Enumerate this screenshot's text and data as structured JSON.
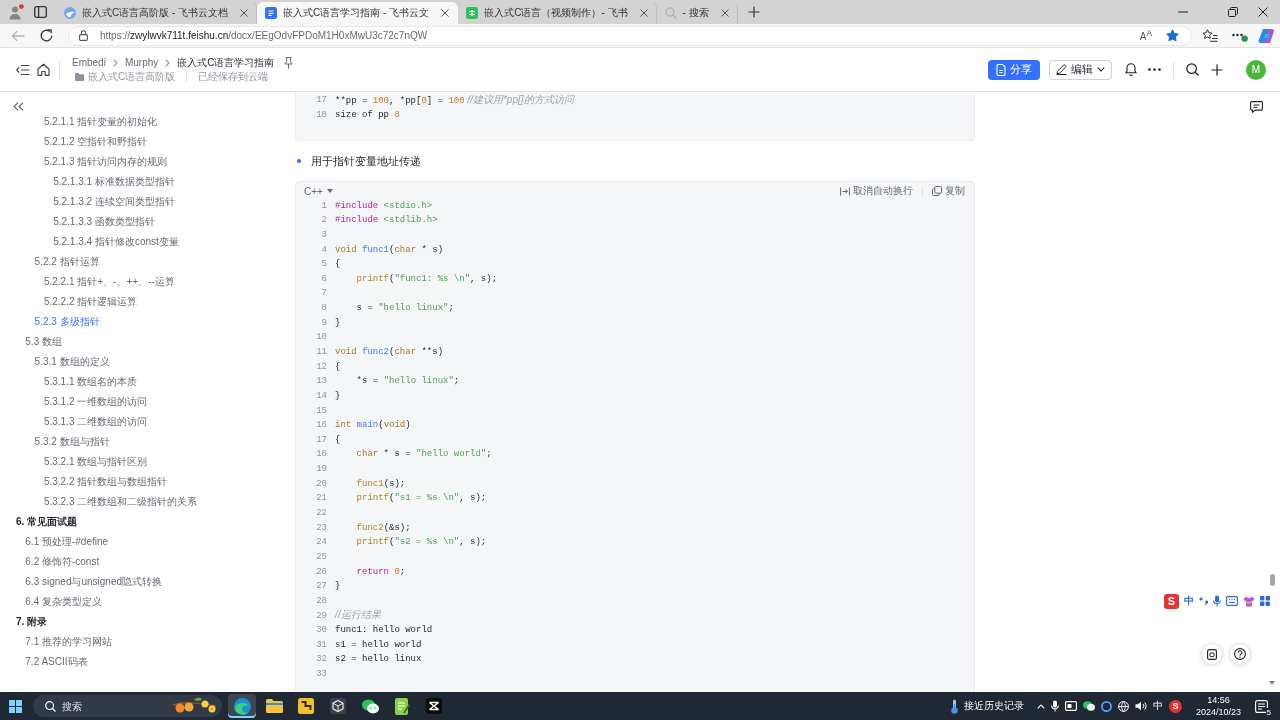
{
  "browser": {
    "tabs": [
      {
        "title": "嵌入式C语言高阶版 - 飞书云文档",
        "kind": "ball",
        "selected": false
      },
      {
        "title": "嵌入式C语言学习指南 - 飞书云文",
        "kind": "doc",
        "selected": true
      },
      {
        "title": "嵌入式C语言（视频制作）- 飞书",
        "kind": "sheet",
        "selected": false
      },
      {
        "title": "- 搜索",
        "kind": "search",
        "selected": false
      }
    ],
    "back_disabled": true,
    "url": {
      "scheme": "https://",
      "host": "zwylwvk711t.feishu.cn",
      "path": "/docx/EEgOdvFPDoM1H0xMwU3c72c7nQW"
    },
    "read_aloud": "A$^{A}$",
    "favorited": true
  },
  "doc_header": {
    "breadcrumb": [
      "Embedi",
      "Murphy",
      "嵌入式C语言学习指南"
    ],
    "location": "嵌入式C语言高阶版",
    "save_status": "已经保存到云端",
    "share_label": "分享",
    "edit_label": "编辑",
    "avatar": "M"
  },
  "toc": [
    {
      "children": [
        {
          "children": [
            {
              "children": [
                {
                  "label": "5.2.1.1 指针变量的初始化",
                  "selected": false
                },
                {
                  "label": "5.2.1.2 空指针和野指针",
                  "selected": false
                },
                {
                  "label": "5.2.1.3 指针访问内存的规则",
                  "selected": false,
                  "children": [
                    {
                      "label": "5.2.1.3.1 标准数据类型指针",
                      "selected": false
                    },
                    {
                      "label": "5.2.1.3.2 连续空间类型指针",
                      "selected": false
                    },
                    {
                      "label": "5.2.1.3.3 函数类型指针",
                      "selected": false
                    },
                    {
                      "label": "5.2.1.3.4 指针修改const变量",
                      "selected": false
                    }
                  ]
                }
              ]
            },
            {
              "label": "5.2.2 指针运算",
              "selected": false,
              "children": [
                {
                  "label": "5.2.2.1 指针+、-、++、--运算",
                  "selected": false
                },
                {
                  "label": "5.2.2.2 指针逻辑运算",
                  "selected": false
                }
              ]
            },
            {
              "label": "5.2.3 多级指针",
              "selected": true
            }
          ]
        },
        {
          "label": "5.3 数组",
          "selected": false,
          "children": [
            {
              "label": "5.3.1 数组的定义",
              "selected": false,
              "children": [
                {
                  "label": "5.3.1.1 数组名的本质",
                  "selected": false
                },
                {
                  "label": "5.3.1.2 一维数组的访问",
                  "selected": false
                },
                {
                  "label": "5.3.1.3 二维数组的访问",
                  "selected": false
                }
              ]
            },
            {
              "label": "5.3.2 数组与指针",
              "selected": false,
              "children": [
                {
                  "label": "5.3.2.1 数组与指针区别",
                  "selected": false
                },
                {
                  "label": "5.3.2.2 指针数组与数组指针",
                  "selected": false
                },
                {
                  "label": "5.3.2.3 二维数组和二级指针的关系",
                  "selected": false
                }
              ]
            }
          ]
        }
      ]
    },
    {
      "label": "6. 常见面试题",
      "selected": false,
      "children": [
        {
          "label": "6.1 预处理-#define",
          "selected": false
        },
        {
          "label": "6.2 修饰符-const",
          "selected": false
        },
        {
          "label": "6.3 signed与unsigned隐式转换",
          "selected": false
        },
        {
          "label": "6.4 复杂类型定义",
          "selected": false
        }
      ]
    },
    {
      "label": "7. 附录",
      "selected": false,
      "children": [
        {
          "label": "7.1 推荐的学习网站",
          "selected": false
        },
        {
          "label": "7.2 ASCII码表",
          "selected": false
        }
      ]
    }
  ],
  "content": [
    {
      "kind": "code",
      "continued": true,
      "lines": [
        {
          "number": "17",
          "tokens": [
            {
              "kind": "plain",
              "text": "**pp = "
            },
            {
              "kind": "number",
              "text": "100"
            },
            {
              "kind": "plain",
              "text": ", *pp["
            },
            {
              "kind": "number",
              "text": "0"
            },
            {
              "kind": "plain",
              "text": "] = "
            },
            {
              "kind": "number",
              "text": "100"
            },
            {
              "kind": "comment",
              "text": " //建议用*pp[]的方式访问"
            }
          ]
        },
        {
          "number": "18",
          "tokens": [
            {
              "kind": "plain",
              "text": "size of pp "
            },
            {
              "kind": "number",
              "text": "8"
            }
          ]
        }
      ]
    },
    {
      "kind": "bullet",
      "text": "用于指针变量地址传递"
    },
    {
      "kind": "code",
      "continued": false,
      "language": "C++",
      "wrap_label": "取消自动换行",
      "copy_label": "复制",
      "lines": [
        {
          "number": "1",
          "tokens": [
            {
              "kind": "preproc",
              "text": "#include "
            },
            {
              "kind": "string",
              "text": "<stdio.h>"
            }
          ]
        },
        {
          "number": "2",
          "tokens": [
            {
              "kind": "preproc",
              "text": "#include "
            },
            {
              "kind": "string",
              "text": "<stdlib.h>"
            }
          ]
        },
        {
          "number": "3"
        },
        {
          "number": "4",
          "tokens": [
            {
              "kind": "type",
              "text": "void "
            },
            {
              "kind": "func",
              "text": "func1"
            },
            {
              "kind": "plain",
              "text": "("
            },
            {
              "kind": "type",
              "text": "char"
            },
            {
              "kind": "plain",
              "text": " * s)"
            }
          ]
        },
        {
          "number": "5",
          "tokens": [
            {
              "kind": "plain",
              "text": "{"
            }
          ]
        },
        {
          "number": "6",
          "tokens": [
            {
              "kind": "call",
              "text": "    printf"
            },
            {
              "kind": "plain",
              "text": "("
            },
            {
              "kind": "string",
              "text": "\"func1: %s \\n\""
            },
            {
              "kind": "plain",
              "text": ", s);"
            }
          ]
        },
        {
          "number": "7"
        },
        {
          "number": "8",
          "tokens": [
            {
              "kind": "plain",
              "text": "    s = "
            },
            {
              "kind": "string",
              "text": "\"hello linux\""
            },
            {
              "kind": "plain",
              "text": ";"
            }
          ]
        },
        {
          "number": "9",
          "tokens": [
            {
              "kind": "plain",
              "text": "}"
            }
          ]
        },
        {
          "number": "10"
        },
        {
          "number": "11",
          "tokens": [
            {
              "kind": "type",
              "text": "void "
            },
            {
              "kind": "func",
              "text": "func2"
            },
            {
              "kind": "plain",
              "text": "("
            },
            {
              "kind": "type",
              "text": "char"
            },
            {
              "kind": "plain",
              "text": " **s)"
            }
          ]
        },
        {
          "number": "12",
          "tokens": [
            {
              "kind": "plain",
              "text": "{"
            }
          ]
        },
        {
          "number": "13",
          "tokens": [
            {
              "kind": "plain",
              "text": "    *s = "
            },
            {
              "kind": "string",
              "text": "\"hello linux\""
            },
            {
              "kind": "plain",
              "text": ";"
            }
          ]
        },
        {
          "number": "14",
          "tokens": [
            {
              "kind": "plain",
              "text": "}"
            }
          ]
        },
        {
          "number": "15"
        },
        {
          "number": "16",
          "tokens": [
            {
              "kind": "type",
              "text": "int "
            },
            {
              "kind": "func",
              "text": "main"
            },
            {
              "kind": "plain",
              "text": "("
            },
            {
              "kind": "type",
              "text": "void"
            },
            {
              "kind": "plain",
              "text": ")"
            }
          ]
        },
        {
          "number": "17",
          "tokens": [
            {
              "kind": "plain",
              "text": "{"
            }
          ]
        },
        {
          "number": "18",
          "tokens": [
            {
              "kind": "type",
              "text": "    char"
            },
            {
              "kind": "plain",
              "text": " * s = "
            },
            {
              "kind": "string",
              "text": "\"hello world\""
            },
            {
              "kind": "plain",
              "text": ";"
            }
          ]
        },
        {
          "number": "19"
        },
        {
          "number": "20",
          "tokens": [
            {
              "kind": "call",
              "text": "    func1"
            },
            {
              "kind": "plain",
              "text": "(s);"
            }
          ]
        },
        {
          "number": "21",
          "tokens": [
            {
              "kind": "call",
              "text": "    printf"
            },
            {
              "kind": "plain",
              "text": "("
            },
            {
              "kind": "string",
              "text": "\"s1 = %s \\n\""
            },
            {
              "kind": "plain",
              "text": ", s);"
            }
          ]
        },
        {
          "number": "22"
        },
        {
          "number": "23",
          "tokens": [
            {
              "kind": "call",
              "text": "    func2"
            },
            {
              "kind": "plain",
              "text": "(&s);"
            }
          ]
        },
        {
          "number": "24",
          "tokens": [
            {
              "kind": "call",
              "text": "    printf"
            },
            {
              "kind": "plain",
              "text": "("
            },
            {
              "kind": "string",
              "text": "\"s2 = %s \\n\""
            },
            {
              "kind": "plain",
              "text": ", s);"
            }
          ]
        },
        {
          "number": "25"
        },
        {
          "number": "26",
          "tokens": [
            {
              "kind": "keyword",
              "text": "    return "
            },
            {
              "kind": "number",
              "text": "0"
            },
            {
              "kind": "plain",
              "text": ";"
            }
          ]
        },
        {
          "number": "27",
          "tokens": [
            {
              "kind": "plain",
              "text": "}"
            }
          ]
        },
        {
          "number": "28"
        },
        {
          "number": "29",
          "tokens": [
            {
              "kind": "comment",
              "text": "//运行结果"
            }
          ]
        },
        {
          "number": "30",
          "tokens": [
            {
              "kind": "plain",
              "text": "func1: hello world"
            }
          ]
        },
        {
          "number": "31",
          "tokens": [
            {
              "kind": "plain",
              "text": "s1 = hello world"
            }
          ]
        },
        {
          "number": "32",
          "tokens": [
            {
              "kind": "plain",
              "text": "s2 = hello linux"
            }
          ]
        },
        {
          "number": "33"
        }
      ]
    }
  ],
  "ime_toolbar": {
    "logo": "S",
    "mode": "中"
  },
  "taskbar": {
    "search": {
      "placeholder": "搜索"
    },
    "apps": [
      {
        "kind": "wave",
        "selected": true
      },
      {
        "kind": "folder",
        "selected": false
      },
      {
        "kind": "tile",
        "selected": false
      },
      {
        "kind": "cube",
        "selected": false
      },
      {
        "kind": "chat",
        "selected": false
      },
      {
        "kind": "notepad",
        "selected": false
      },
      {
        "kind": "hourglass",
        "selected": false
      }
    ],
    "weather": "接近历史记录",
    "ime_mode": "中",
    "ime_logo": "S",
    "time": "14:56",
    "date": "2024/10/23",
    "notifications": "5"
  }
}
